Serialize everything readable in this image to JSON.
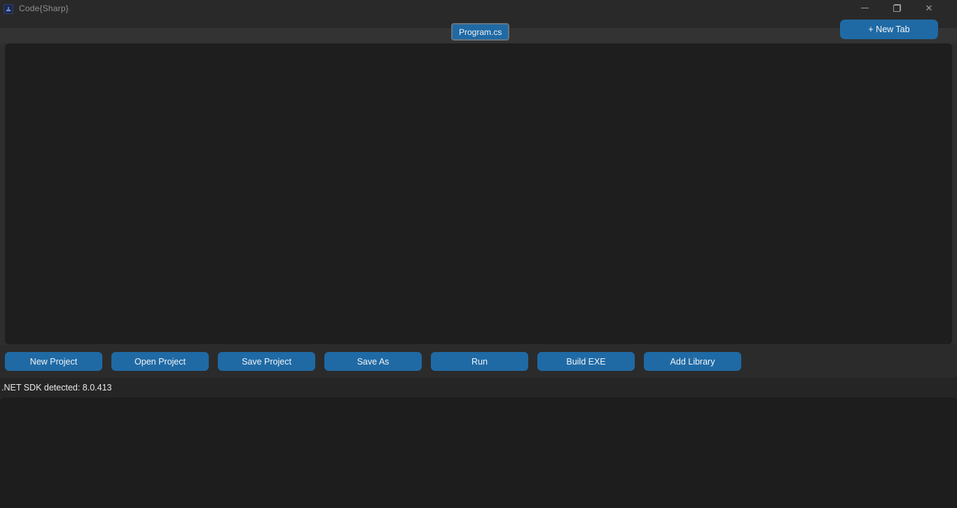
{
  "window": {
    "title": "Code{Sharp}",
    "controls": {
      "close_glyph": "✕"
    }
  },
  "tabs": {
    "active_tab": "Program.cs",
    "new_tab_label": "+ New Tab"
  },
  "editor": {
    "content": ""
  },
  "toolbar": {
    "buttons": [
      "New Project",
      "Open Project",
      "Save Project",
      "Save As",
      "Run",
      "Build EXE",
      "Add Library"
    ]
  },
  "statusbar": {
    "text": ".NET SDK detected: 8.0.413"
  },
  "console": {
    "content": ""
  },
  "colors": {
    "accent": "#1f6aa5",
    "titlebar_bg": "#292929",
    "tabstrip_bg": "#333333",
    "editor_bg": "#1e1e1e",
    "toolbar_bg": "#2b2b2b",
    "statusbar_bg": "#252525",
    "console_bg": "#1d1d1d",
    "tab_border": "#66747f"
  }
}
